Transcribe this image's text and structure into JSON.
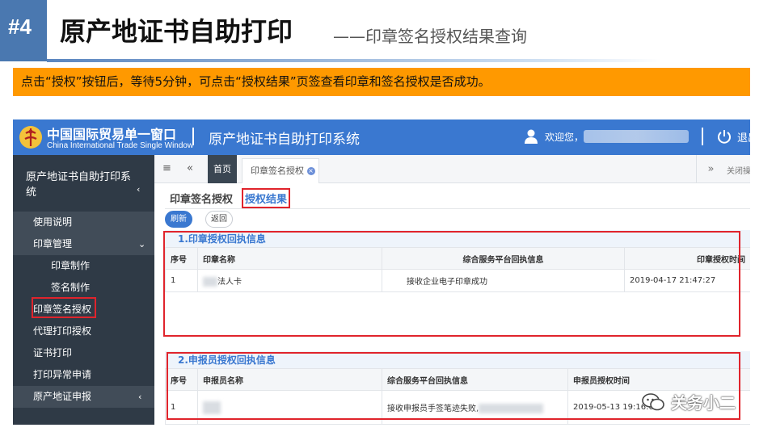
{
  "slide": {
    "badge": "#4",
    "title": "原产地证书自助打印",
    "subtitle": "——印章签名授权结果查询",
    "note": "点击“授权”按钮后，等待5分钟，可点击“授权结果”页签查看印章和签名授权是否成功。"
  },
  "app": {
    "brand_cn": "中国国际贸易单一窗口",
    "brand_en": "China International Trade Single Window",
    "system_title": "原产地证书自助打印系统",
    "welcome": "欢迎您，",
    "logout": "退出"
  },
  "sidebar": {
    "header": "原产地证书自助打印系统",
    "items": [
      {
        "label": "使用说明"
      },
      {
        "label": "印章管理"
      },
      {
        "label": "印章制作"
      },
      {
        "label": "签名制作"
      },
      {
        "label": "印章签名授权"
      },
      {
        "label": "代理打印授权"
      },
      {
        "label": "证书打印"
      },
      {
        "label": "打印异常申请"
      },
      {
        "label": "原产地证申报"
      }
    ]
  },
  "tabs": {
    "home": "首页",
    "active": "印章签名授权",
    "close_all": "关闭操"
  },
  "subtabs": {
    "first": "印章签名授权",
    "second": "授权结果"
  },
  "buttons": {
    "refresh": "刷新",
    "back": "返回"
  },
  "section1": {
    "title": "1.印章授权回执信息",
    "columns": [
      "序号",
      "印章名称",
      "综合服务平台回执信息",
      "印章授权时间"
    ],
    "rows": [
      {
        "index": "1",
        "name": "法人卡",
        "receipt": "接收企业电子印章成功",
        "time": "2019-04-17 21:47:27"
      }
    ]
  },
  "section2": {
    "title": "2.申报员授权回执信息",
    "columns": [
      "序号",
      "申报员名称",
      "综合服务平台回执信息",
      "申报员授权时间"
    ],
    "rows": [
      {
        "index": "1",
        "name": "",
        "receipt": "接收申报员手签笔迹失败,",
        "time": "2019-05-13 19:16:0"
      }
    ]
  },
  "watermark": "关务小二",
  "colors": {
    "accent": "#3a78d0",
    "sidebar": "#2f3a46",
    "highlight": "#e0242c",
    "note_bg": "#ff9900"
  }
}
